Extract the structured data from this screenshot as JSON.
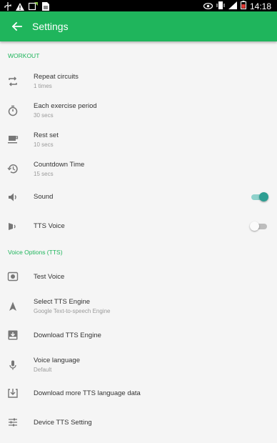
{
  "status_bar": {
    "time": "14:18",
    "icons": [
      "usb-icon",
      "warning-icon",
      "rotate-icon",
      "sim-icon",
      "eye-icon",
      "vibrate-icon",
      "signal-icon",
      "battery-icon"
    ]
  },
  "app_bar": {
    "title": "Settings",
    "back_icon": "arrow-back-icon",
    "color": "#1fb55c"
  },
  "workout": {
    "header": "WORKOUT",
    "repeat_circuits": {
      "label": "Repeat circuits",
      "value": "1 times",
      "icon": "repeat-icon"
    },
    "exercise_period": {
      "label": "Each exercise period",
      "value": "30 secs",
      "icon": "stopwatch-icon"
    },
    "rest_set": {
      "label": "Rest set",
      "value": "10 secs",
      "icon": "coffee-icon"
    },
    "countdown": {
      "label": "Countdown Time",
      "value": "15 secs",
      "icon": "history-icon"
    },
    "sound": {
      "label": "Sound",
      "icon": "volume-icon",
      "enabled": true
    },
    "tts_voice": {
      "label": "TTS Voice",
      "icon": "voice-icon",
      "enabled": false
    }
  },
  "voice_options": {
    "header": "Voice Options (TTS)",
    "test_voice": {
      "label": "Test Voice",
      "icon": "speaker-icon"
    },
    "select_engine": {
      "label": "Select TTS Engine",
      "value": "Google Text-to-speech Engine",
      "icon": "navigation-icon"
    },
    "download_engine": {
      "label": "Download TTS Engine",
      "icon": "inbox-download-icon"
    },
    "voice_language": {
      "label": "Voice language",
      "value": "Default",
      "icon": "microphone-icon"
    },
    "download_language": {
      "label": "Download more TTS language data",
      "icon": "download-icon"
    },
    "device_setting": {
      "label": "Device TTS Setting",
      "icon": "tune-icon"
    }
  },
  "colors": {
    "accent": "#1fb55c",
    "switch_on": "#2e9e92"
  }
}
